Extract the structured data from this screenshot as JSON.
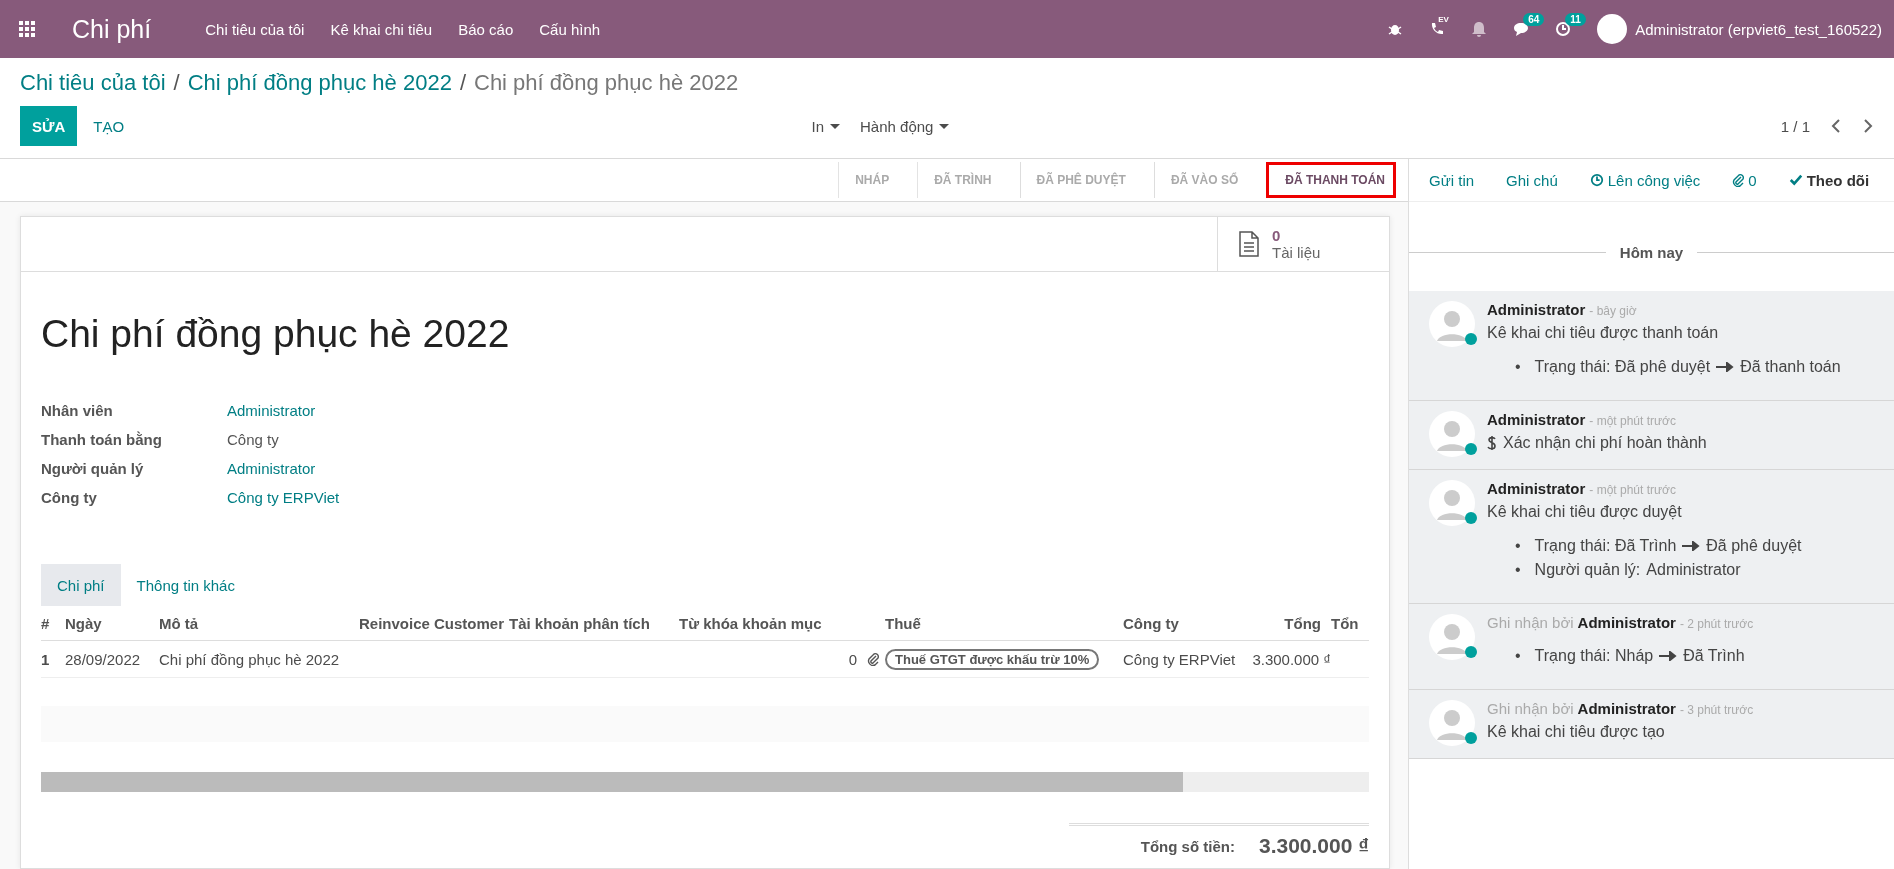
{
  "navbar": {
    "app_name": "Chi phí",
    "menu": [
      "Chi tiêu của tôi",
      "Kê khai chi tiêu",
      "Báo cáo",
      "Cấu hình"
    ],
    "systray": [
      {
        "kind": "bug"
      },
      {
        "kind": "phone",
        "tag": "EV"
      },
      {
        "kind": "bell"
      },
      {
        "kind": "chat",
        "badge": "64"
      },
      {
        "kind": "clock",
        "badge": "11"
      }
    ],
    "user": "Administrator (erpviet6_test_160522)"
  },
  "breadcrumb": [
    {
      "label": "Chi tiêu của tôi"
    },
    {
      "separator": "/",
      "label": "Chi phí đồng phục hè 2022"
    },
    {
      "separator": "/",
      "label": "Chi phí đồng phục hè 2022"
    }
  ],
  "buttons": {
    "primary": "SỬA",
    "secondary": "TẠO"
  },
  "actions": [
    "In",
    "Hành động"
  ],
  "pager": "1 / 1",
  "stages": [
    {
      "label": "NHÁP",
      "selected": false
    },
    {
      "label": "ĐÃ TRÌNH",
      "selected": false
    },
    {
      "label": "ĐÃ PHÊ DUYỆT",
      "selected": false
    },
    {
      "label": "ĐÃ VÀO SỔ",
      "selected": false
    },
    {
      "label": "ĐÃ THANH TOÁN",
      "selected": true
    }
  ],
  "smart_button": {
    "count": "0",
    "label": "Tài liệu"
  },
  "title": "Chi phí đồng phục hè 2022",
  "fields": [
    {
      "label": "Nhân viên",
      "value": "Administrator",
      "link": true
    },
    {
      "label": "Thanh toán bằng",
      "value": "Công ty",
      "link": false
    },
    {
      "label": "Người quản lý",
      "value": "Administrator",
      "link": true
    },
    {
      "label": "Công ty",
      "value": "Công ty ERPViet",
      "link": true
    }
  ],
  "tabs": [
    {
      "label": "Chi phí",
      "selected": true
    },
    {
      "label": "Thông tin khác",
      "selected": false
    }
  ],
  "table": {
    "columns": [
      "#",
      "Ngày",
      "Mô tả",
      "Reinvoice Customer",
      "Tài khoản phân tích",
      "Từ khóa khoản mục",
      "Thuế",
      "Công ty",
      "Tổng",
      "Tổn"
    ],
    "rows": [
      {
        "seq": "1",
        "date": "28/09/2022",
        "description": "Chi phí đồng phục hè 2022",
        "attachments": "0",
        "tax": "Thuế GTGT được khấu trừ 10%",
        "company": "Công ty ERPViet",
        "total": "3.300.000 ₫"
      }
    ]
  },
  "total": {
    "label": "Tổng số tiền:",
    "value": "3.300.000 ₫"
  },
  "chatter": {
    "actions": [
      {
        "kind": "text",
        "label": "Gửi tin"
      },
      {
        "kind": "text",
        "label": "Ghi chú"
      },
      {
        "kind": "clock",
        "label": "Lên công việc"
      },
      {
        "kind": "clip",
        "label": "0"
      },
      {
        "kind": "check",
        "label": "Theo dõi"
      }
    ],
    "date_separator": "Hôm nay",
    "messages": [
      {
        "kind": "message",
        "author": "Administrator",
        "time": "- bây giờ",
        "body": "Kê khai chi tiêu được thanh toán",
        "tracking": [
          {
            "bullet": "•",
            "field": "Trạng thái:",
            "old": "Đã phê duyệt",
            "new": "Đã thanh toán"
          }
        ]
      },
      {
        "kind": "activity",
        "author": "Administrator",
        "time": "- một phút trước",
        "body": "Xác nhận chi phí hoàn thành"
      },
      {
        "kind": "message",
        "author": "Administrator",
        "time": "- một phút trước",
        "body": "Kê khai chi tiêu được duyệt",
        "tracking": [
          {
            "bullet": "•",
            "field": "Trạng thái:",
            "old": "Đã Trình",
            "new": "Đã phê duyệt"
          },
          {
            "bullet": "•",
            "field": "Người quản lý:",
            "new": "Administrator"
          }
        ]
      },
      {
        "kind": "tracking",
        "prefix": "Ghi nhận bởi",
        "author": "Administrator",
        "time": "- 2 phút trước",
        "tracking": [
          {
            "bullet": "•",
            "field": "Trạng thái:",
            "old": "Nháp",
            "new": "Đã Trình"
          }
        ]
      },
      {
        "kind": "tracking",
        "prefix": "Ghi nhận bởi",
        "author": "Administrator",
        "time": "- 3 phút trước",
        "body": "Kê khai chi tiêu được tạo"
      }
    ]
  }
}
